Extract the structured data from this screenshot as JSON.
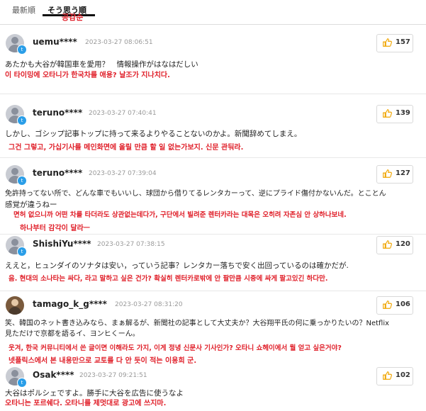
{
  "tabs": {
    "latest": "最新順",
    "active": "そう思う順",
    "active_note": "공감순"
  },
  "colors": {
    "accent": "#e0202a",
    "like_icon": "#f0a500",
    "badge": "#2a9ee8"
  },
  "comments": [
    {
      "user": "uemu****",
      "date": "2023-03-27 08:06:51",
      "likes": "157",
      "text": "あたかも大谷が韓国車を愛用？　情報操作がはなはだしい",
      "translation": [
        "이 타이밍에 오타니가 한국차를 애용? 날조가 지나치다."
      ]
    },
    {
      "user": "teruno****",
      "date": "2023-03-27 07:40:41",
      "likes": "139",
      "text": "しかし、ゴシップ記事トップに持って来るよりやることないのかよ。新聞辞めてしまえ。",
      "translation": [
        "그건 그렇고, 가십기사를 메인화면에 올릴 만큼 할 일 없는가보지. 신문 관둬라."
      ]
    },
    {
      "user": "teruno****",
      "date": "2023-03-27 07:39:04",
      "likes": "127",
      "text": "免許持ってない所で、どんな車でもいいし、球団から借りてるレンタカーって、逆にプライド傷付かないんだ。とことん",
      "text2": "感覚が違うねー",
      "translation": [
        "면허 없으니까 어떤 차를 타더라도 상관없는데다가, 구단에서 빌려준 렌터카라는 대목은 오히려 자존심 안 상하나보네.",
        "하나부터 감각이 달라ㅡ"
      ]
    },
    {
      "user": "ShishiYu****",
      "date": "2023-03-27 07:38:15",
      "likes": "120",
      "text": "ええと，ヒュンダイのソナタは安い，っていう記事？レンタカー落ちで安く出回っているのは確かだが.",
      "translation": [
        "음. 현대의 소나타는 싸다, 라고 말하고 싶은 건가? 확실히 렌터카로밖에 안 팔만큼 시중에 싸게 팔고있긴 하다만."
      ]
    },
    {
      "user": "tamago_k_g****",
      "date": "2023-03-27 08:31:20",
      "likes": "106",
      "text": "笑、韓国のネット書き込みなら、まぁ解るが、新聞社の記事として大丈夫か？大谷翔平氏の何に乗っかりたいの？Netflix",
      "text2": "見ただけで京都を語るイ、ヨンヒくーん。",
      "translation": [
        "웃겨, 한국 커뮤니티에서 쓴 글이면 이해라도 가지, 이게 정녕 신문사 기사인가? 오타니 쇼헤이에서 뭘 얻고 싶은거야?",
        "넷플릭스에서 본 내용만으로 교토를 다 안 듯이 적는 이용희 군."
      ]
    },
    {
      "user": "Osak****",
      "date": "2023-03-27 09:21:51",
      "likes": "102",
      "text": "大谷はポルシェですよ。勝手に大谷を広告に使うなよ",
      "translation": [
        "오타니는 포르쉐다. 오타니를 제멋대로 광고에 쓰지마."
      ]
    }
  ]
}
